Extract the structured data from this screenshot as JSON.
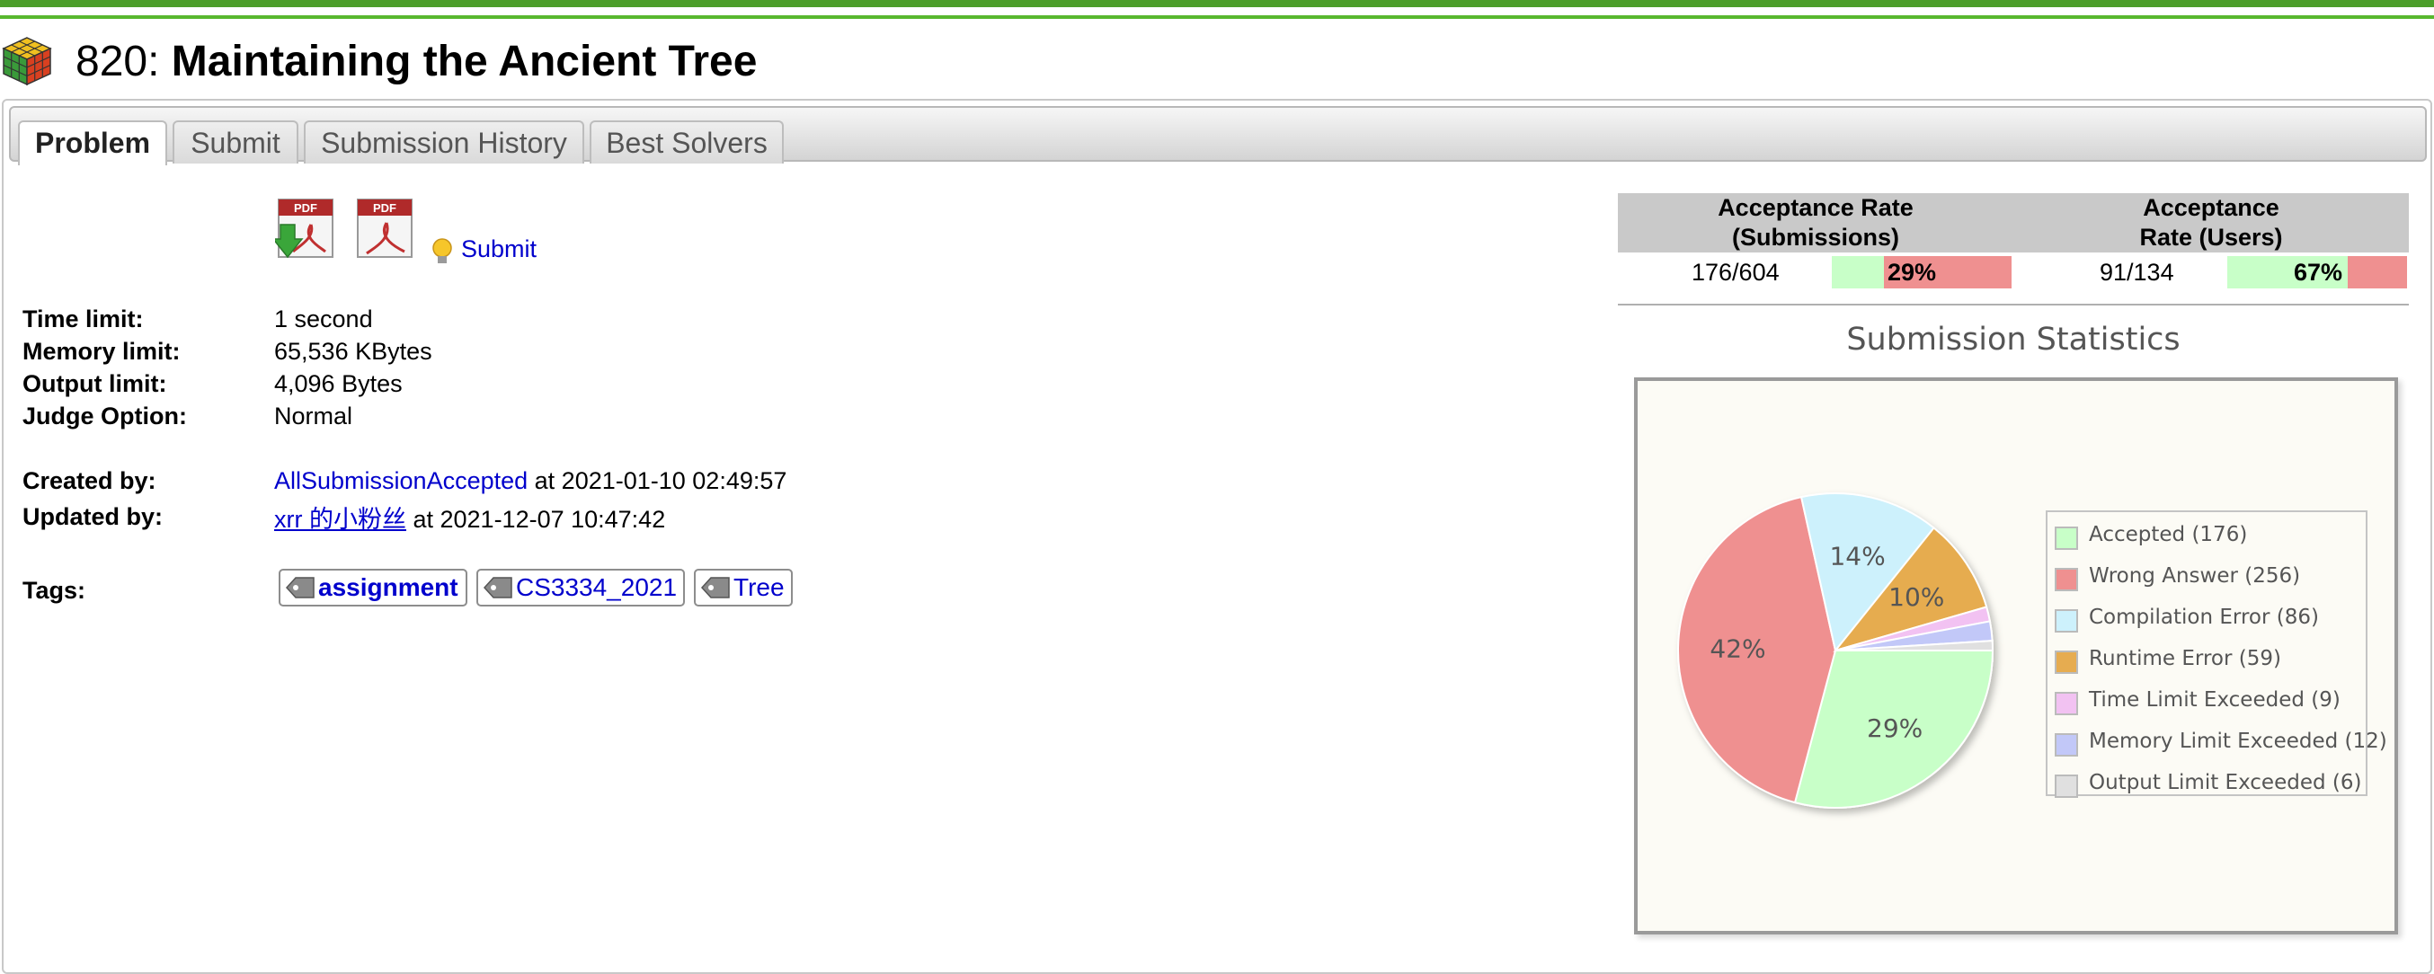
{
  "header": {
    "problem_number": "820:",
    "problem_title": "Maintaining the Ancient Tree"
  },
  "tabs": [
    {
      "label": "Problem",
      "active": true
    },
    {
      "label": "Submit",
      "active": false
    },
    {
      "label": "Submission History",
      "active": false
    },
    {
      "label": "Best Solvers",
      "active": false
    }
  ],
  "actions": {
    "submit_link": "Submit",
    "icons": [
      "pdf-download-icon",
      "pdf-icon",
      "lightbulb-icon"
    ]
  },
  "limits": {
    "time_label": "Time limit:",
    "time_value": "1 second",
    "memory_label": "Memory limit:",
    "memory_value": "65,536 KBytes",
    "output_label": "Output limit:",
    "output_value": "4,096 Bytes",
    "judge_label": "Judge Option:",
    "judge_value": "Normal"
  },
  "authors": {
    "created_label": "Created by:",
    "created_user": "AllSubmissionAccepted",
    "created_at": " at 2021-01-10 02:49:57",
    "updated_label": "Updated by:",
    "updated_user": "xrr 的小粉丝",
    "updated_at": " at 2021-12-07 10:47:42"
  },
  "tags": {
    "label": "Tags:",
    "items": [
      "assignment",
      "CS3334_2021",
      "Tree"
    ]
  },
  "acceptance": {
    "submissions_header": "Acceptance Rate (Submissions)",
    "submissions_count": "176/604",
    "submissions_pct": "29%",
    "submissions_fraction": 0.29,
    "users_header": "Acceptance Rate (Users)",
    "users_count": "91/134",
    "users_pct": "67%",
    "users_fraction": 0.67,
    "colors": {
      "accepted": "#c8ffc8",
      "rejected": "#ef9090"
    }
  },
  "stats": {
    "title": "Submission Statistics"
  },
  "chart_data": {
    "type": "pie",
    "categories": [
      "Accepted (176)",
      "Wrong Answer (256)",
      "Compilation Error (86)",
      "Runtime Error (59)",
      "Time Limit Exceeded (9)",
      "Memory Limit Exceeded (12)",
      "Output Limit Exceeded (6)"
    ],
    "values": [
      176,
      256,
      86,
      59,
      9,
      12,
      6
    ],
    "colors": [
      "#c8ffc8",
      "#ef9090",
      "#cdf1fc",
      "#e6ac50",
      "#f2c2f2",
      "#c2c8f8",
      "#e0e0e0"
    ],
    "labels": [
      "29%",
      "42%",
      "14%",
      "10%",
      "",
      "",
      ""
    ],
    "legend": "right"
  }
}
